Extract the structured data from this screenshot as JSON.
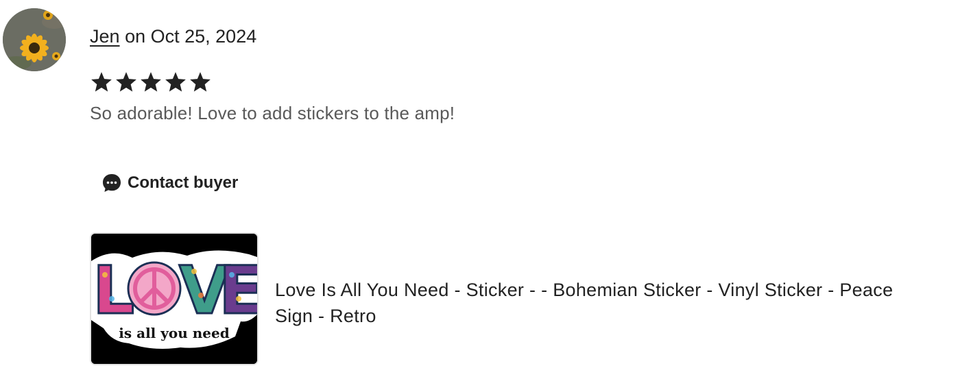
{
  "review": {
    "reviewer_name": "Jen",
    "date_prefix": "on",
    "date": "Oct 25, 2024",
    "rating": 5,
    "rating_max": 5,
    "text": "So adorable! Love to add stickers to the amp!"
  },
  "actions": {
    "contact_label": "Contact buyer",
    "contact_icon": "chat-bubble-icon"
  },
  "product": {
    "title": "Love Is All You Need - Sticker - - Bohemian Sticker - Vinyl Sticker - Peace Sign - Retro",
    "thumbnail_word": "LOVE",
    "thumbnail_caption": "is all you need"
  },
  "colors": {
    "text": "#222222",
    "muted_text": "#595959",
    "star": "#222222",
    "thumb_border": "#e3e3e3"
  }
}
